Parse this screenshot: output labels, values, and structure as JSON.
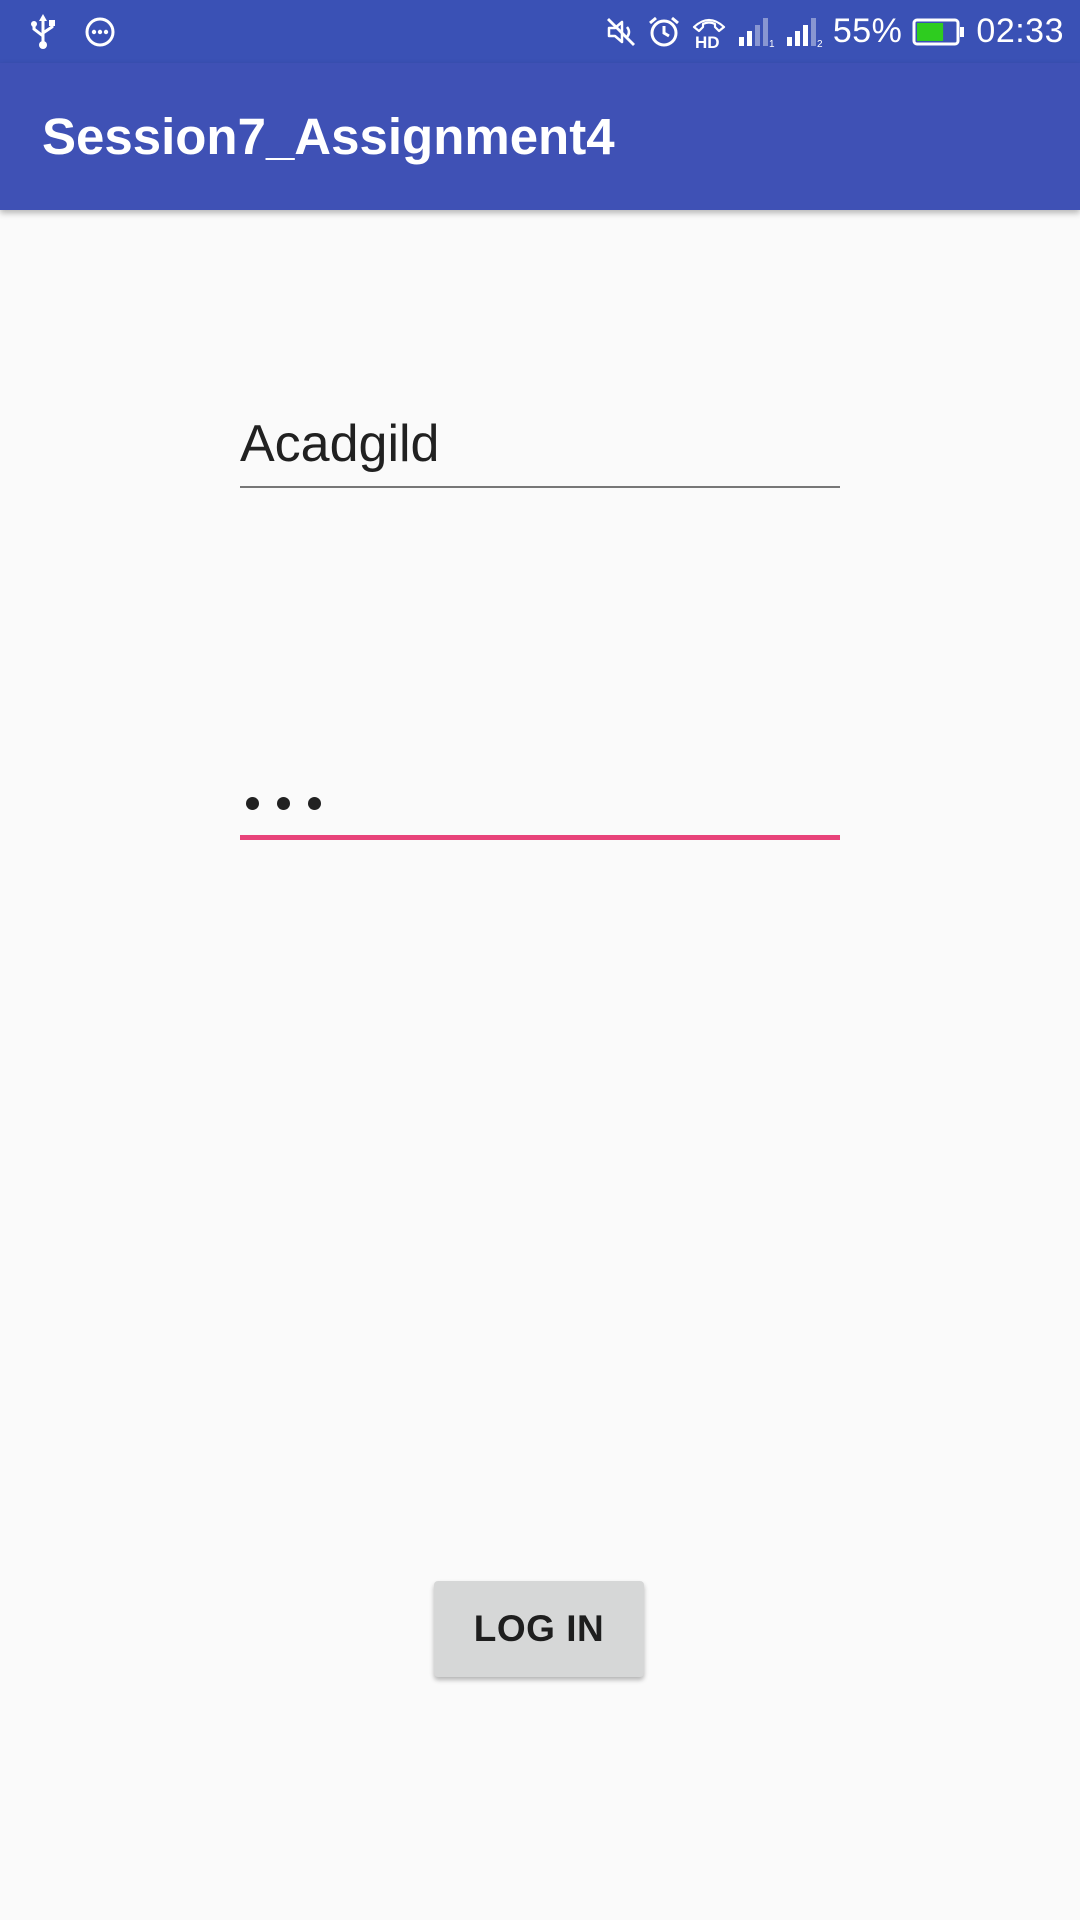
{
  "status_bar": {
    "battery_percent_text": "55%",
    "battery_level": 0.55,
    "time": "02:33",
    "network_label": "HD",
    "left_icons": [
      "usb-icon",
      "more-dots-icon"
    ],
    "right_icons": [
      "mute-icon",
      "alarm-icon",
      "hd-call-icon",
      "signal-icon",
      "signal-icon",
      "battery-icon"
    ],
    "battery_color": "#2ecc1f"
  },
  "app_bar": {
    "title": "Session7_Assignment4",
    "color": "#3f51b5"
  },
  "form": {
    "username": {
      "value": "Acadgild"
    },
    "password": {
      "masked_length": 3,
      "focused": true,
      "accent_color": "#e8437a"
    },
    "login_button": {
      "label": "LOG IN"
    }
  }
}
